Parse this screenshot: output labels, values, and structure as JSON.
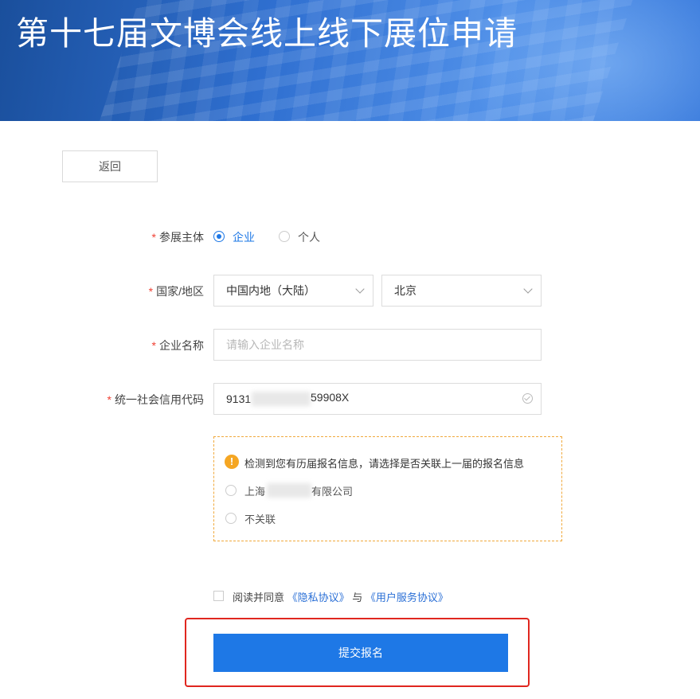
{
  "banner": {
    "title": "第十七届文博会线上线下展位申请"
  },
  "back_button": {
    "label": "返回"
  },
  "form": {
    "subject": {
      "required_mark": "*",
      "label": "参展主体",
      "options": [
        {
          "label": "企业",
          "selected": true
        },
        {
          "label": "个人",
          "selected": false
        }
      ]
    },
    "region": {
      "required_mark": "*",
      "label": "国家/地区",
      "country_value": "中国内地（大陆）",
      "city_value": "北京"
    },
    "company_name": {
      "required_mark": "*",
      "label": "企业名称",
      "placeholder": "请输入企业名称",
      "value": ""
    },
    "credit_code": {
      "required_mark": "*",
      "label": "统一社会信用代码",
      "value_prefix": "9131",
      "value_suffix": "59908X"
    }
  },
  "notice": {
    "icon": "warning-icon",
    "message": "检测到您有历届报名信息，请选择是否关联上一届的报名信息",
    "options": [
      {
        "prefix": "上海",
        "suffix": "有限公司",
        "selected": false
      },
      {
        "label": "不关联",
        "selected": false
      }
    ]
  },
  "agreement": {
    "prefix": "阅读并同意",
    "privacy_link": "《隐私协议》",
    "conjunction": "与",
    "service_link": "《用户服务协议》",
    "checked": false
  },
  "submit_button": {
    "label": "提交报名"
  },
  "colors": {
    "primary": "#1e78e6",
    "required": "#f04134",
    "warning": "#f5a623",
    "highlight": "#e0261f"
  }
}
